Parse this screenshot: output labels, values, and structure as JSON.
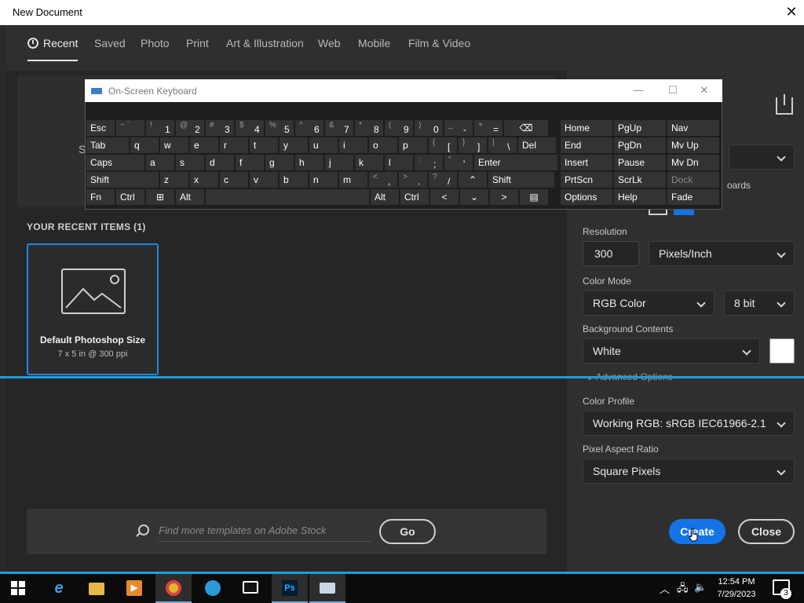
{
  "window": {
    "title": "New Document",
    "close_glyph": "✕"
  },
  "tabs": [
    {
      "label": "Recent",
      "active": true
    },
    {
      "label": "Saved"
    },
    {
      "label": "Photo"
    },
    {
      "label": "Print"
    },
    {
      "label": "Art & Illustration"
    },
    {
      "label": "Web"
    },
    {
      "label": "Mobile"
    },
    {
      "label": "Film & Video"
    }
  ],
  "preset_letter": "S",
  "recent": {
    "heading": "YOUR RECENT ITEMS  (1)",
    "items": [
      {
        "name": "Default Photoshop Size",
        "dims": "7 x 5 in @ 300 ppi"
      }
    ]
  },
  "stock": {
    "placeholder": "Find more templates on Adobe Stock",
    "go_label": "Go"
  },
  "details": {
    "resolution_label": "Resolution",
    "resolution_value": "300",
    "resolution_unit": "Pixels/Inch",
    "color_mode_label": "Color Mode",
    "color_mode": "RGB Color",
    "bit_depth": "8 bit",
    "bg_label": "Background Contents",
    "bg_value": "White",
    "advanced_label": "Advanced Options",
    "profile_label": "Color Profile",
    "profile_value": "Working RGB: sRGB IEC61966-2.1",
    "aspect_label": "Pixel Aspect Ratio",
    "aspect_value": "Square Pixels",
    "clipped_text": "oards"
  },
  "buttons": {
    "create": "Create",
    "close": "Close"
  },
  "osk": {
    "title": "On-Screen Keyboard",
    "controls": {
      "min": "—",
      "max": "☐",
      "close": "✕"
    },
    "row1": [
      {
        "sup": "~ `",
        "main": ""
      },
      {
        "sup": "!",
        "main": "1"
      },
      {
        "sup": "@",
        "main": "2"
      },
      {
        "sup": "#",
        "main": "3"
      },
      {
        "sup": "$",
        "main": "4"
      },
      {
        "sup": "%",
        "main": "5"
      },
      {
        "sup": "^",
        "main": "6"
      },
      {
        "sup": "&",
        "main": "7"
      },
      {
        "sup": "*",
        "main": "8"
      },
      {
        "sup": "(",
        "main": "9"
      },
      {
        "sup": ")",
        "main": "0"
      },
      {
        "sup": "_",
        "main": "-"
      },
      {
        "sup": "+",
        "main": "="
      }
    ],
    "esc": "Esc",
    "tab": "Tab",
    "row2": [
      "q",
      "w",
      "e",
      "r",
      "t",
      "y",
      "u",
      "i",
      "o",
      "p"
    ],
    "brackets": [
      {
        "sup": "{",
        "main": "["
      },
      {
        "sup": "}",
        "main": "]"
      },
      {
        "sup": "|",
        "main": "\\"
      }
    ],
    "del": "Del",
    "caps": "Caps",
    "row3": [
      "a",
      "s",
      "d",
      "f",
      "g",
      "h",
      "j",
      "k",
      "l"
    ],
    "semi": [
      {
        "sup": ":",
        "main": ";"
      },
      {
        "sup": "\"",
        "main": "'"
      }
    ],
    "enter": "Enter",
    "shift": "Shift",
    "row4": [
      "z",
      "x",
      "c",
      "v",
      "b",
      "n",
      "m"
    ],
    "punct": [
      {
        "sup": "<",
        "main": ","
      },
      {
        "sup": ">",
        "main": "."
      },
      {
        "sup": "?",
        "main": "/"
      }
    ],
    "fn": "Fn",
    "ctrl": "Ctrl",
    "alt": "Alt",
    "nav": [
      [
        "Home",
        "PgUp",
        "Nav"
      ],
      [
        "End",
        "PgDn",
        "Mv Up"
      ],
      [
        "Insert",
        "Pause",
        "Mv Dn"
      ],
      [
        "PrtScn",
        "ScrLk",
        "Dock"
      ],
      [
        "Options",
        "Help",
        "Fade"
      ]
    ]
  },
  "taskbar": {
    "time": "12:54 PM",
    "date": "7/29/2023",
    "notifications": "3",
    "apps": [
      "start-icon",
      "ie-icon",
      "explorer-icon",
      "media-icon",
      "chrome-icon",
      "edge-icon",
      "network-drive-icon",
      "photoshop-icon",
      "osk-icon"
    ]
  }
}
